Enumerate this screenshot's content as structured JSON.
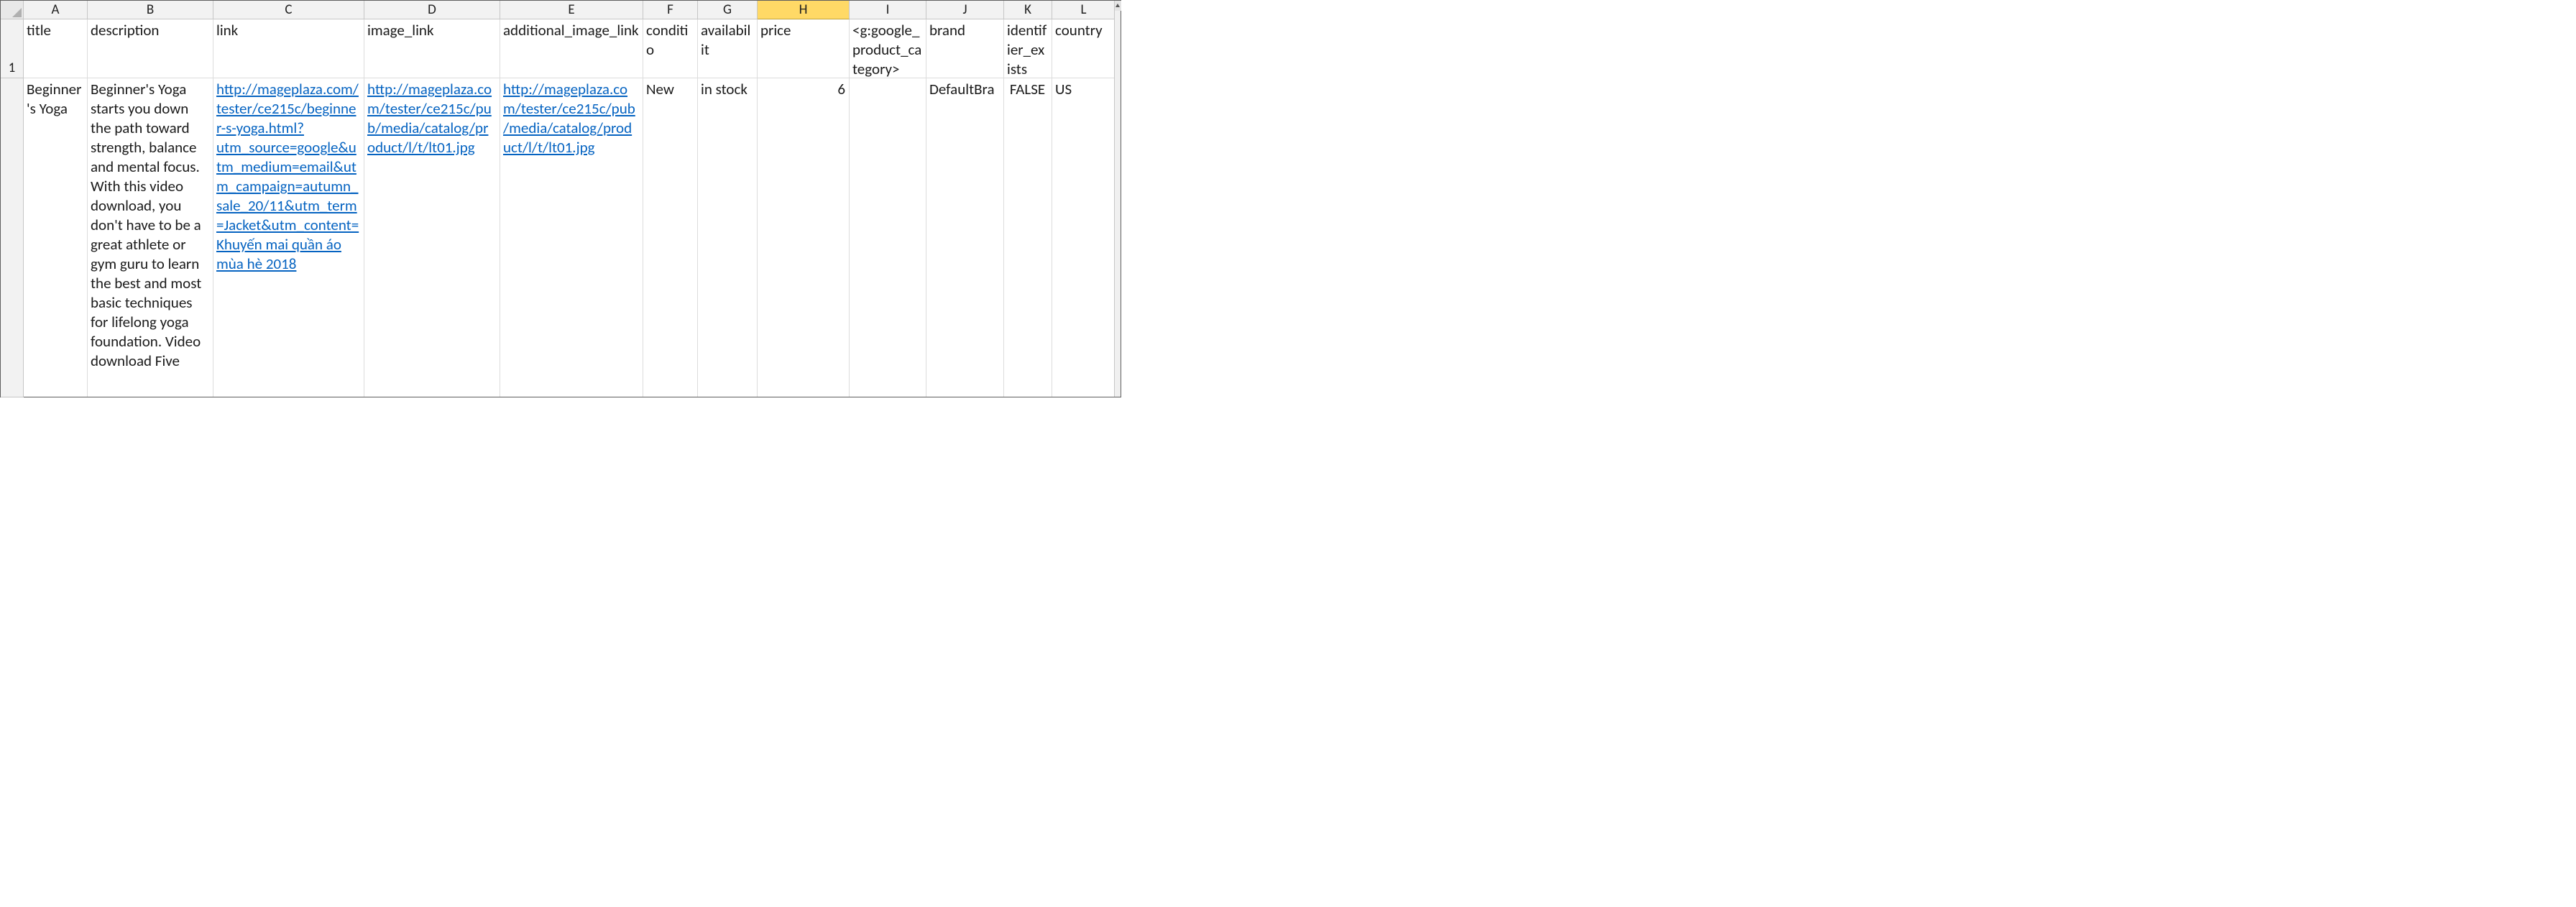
{
  "columns": [
    {
      "letter": "A",
      "width": "wA",
      "selected": false
    },
    {
      "letter": "B",
      "width": "wB",
      "selected": false
    },
    {
      "letter": "C",
      "width": "wC",
      "selected": false
    },
    {
      "letter": "D",
      "width": "wD",
      "selected": false
    },
    {
      "letter": "E",
      "width": "wE",
      "selected": false
    },
    {
      "letter": "F",
      "width": "wF",
      "selected": false
    },
    {
      "letter": "G",
      "width": "wG",
      "selected": false
    },
    {
      "letter": "H",
      "width": "wH",
      "selected": true
    },
    {
      "letter": "I",
      "width": "wI",
      "selected": false
    },
    {
      "letter": "J",
      "width": "wJ",
      "selected": false
    },
    {
      "letter": "K",
      "width": "wK",
      "selected": false
    },
    {
      "letter": "L",
      "width": "wL",
      "selected": false
    }
  ],
  "row1_number": "1",
  "row1_height": 82,
  "headers": {
    "A": "title",
    "B": "description",
    "C": "link",
    "D": "image_link",
    "E": "additional_image_link",
    "F": "conditio",
    "G": "availabilit",
    "H": "price",
    "I": "<g:google_product_category>",
    "J": "brand",
    "K": "identifier_exists",
    "L": "country"
  },
  "row2_height": 444,
  "row2": {
    "A": "Beginner's Yoga",
    "B": "Beginner's Yoga starts you down the path toward strength, balance and mental focus. With this video download, you don't have to be a great athlete or gym guru to learn the best and most basic techniques for lifelong yoga foundation. Video download Five",
    "C": "http://mageplaza.com/tester/ce215c/beginner-s-yoga.html?utm_source=google&utm_medium=email&utm_campaign=autumn_sale_20/11&utm_term=Jacket&utm_content=Khuyến mai quần áo mùa hè 2018",
    "D": "http://mageplaza.com/tester/ce215c/pub/media/catalog/product/l/t/lt01.jpg",
    "E": "http://mageplaza.com/tester/ce215c/pub/media/catalog/product/l/t/lt01.jpg",
    "F": "New",
    "G": "in stock",
    "H": "6",
    "I": "",
    "J": "DefaultBra",
    "K": "FALSE",
    "L": "US"
  }
}
